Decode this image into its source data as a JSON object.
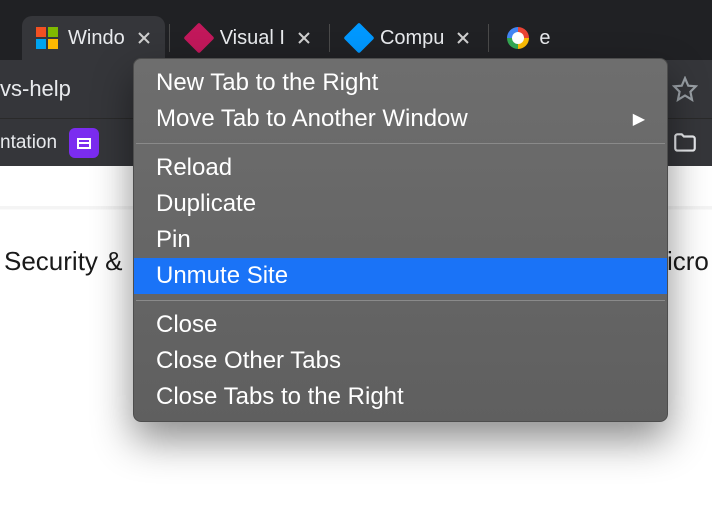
{
  "tabs": [
    {
      "title": "Windo",
      "favicon": "ms"
    },
    {
      "title": "Visual I",
      "favicon": "vs-red"
    },
    {
      "title": "Compu",
      "favicon": "vs-blue"
    },
    {
      "title": "e",
      "favicon": "google"
    }
  ],
  "address_fragment": "vs-help",
  "bookmark_bar": {
    "first_label": "ntation",
    "tile_glyph": "⊞"
  },
  "page_heading": "Security &",
  "page_heading_right": "icro",
  "context_menu": {
    "group1": [
      {
        "label": "New Tab to the Right"
      },
      {
        "label": "Move Tab to Another Window",
        "submenu": true
      }
    ],
    "group2": [
      {
        "label": "Reload"
      },
      {
        "label": "Duplicate"
      },
      {
        "label": "Pin"
      },
      {
        "label": "Unmute Site",
        "highlight": true
      }
    ],
    "group3": [
      {
        "label": "Close"
      },
      {
        "label": "Close Other Tabs"
      },
      {
        "label": "Close Tabs to the Right"
      }
    ]
  }
}
